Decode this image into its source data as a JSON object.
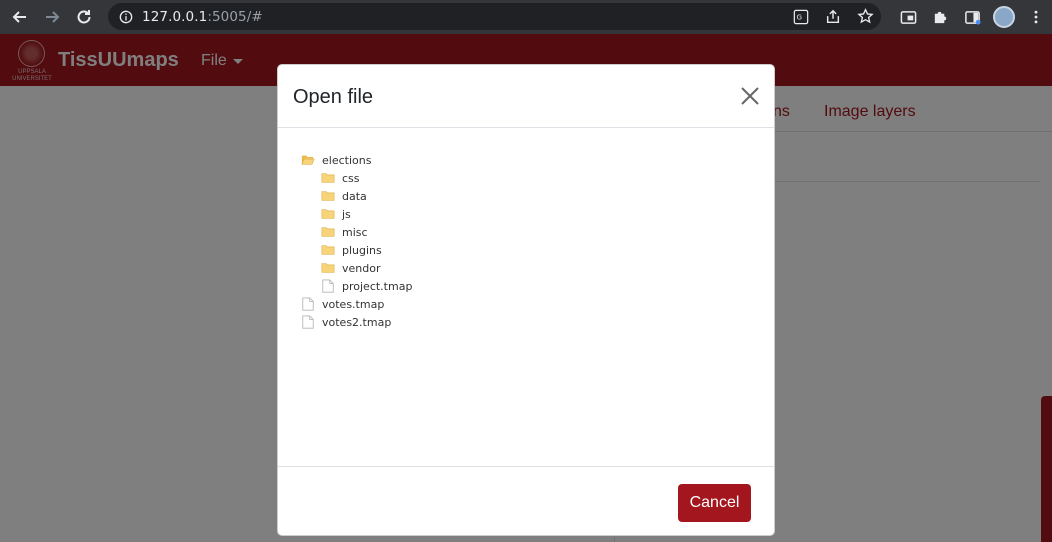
{
  "browser": {
    "url_host": "127.0.0.1",
    "url_rest": ":5005/#"
  },
  "app": {
    "title": "TissUUmaps",
    "logo_text_line1": "UPPSALA",
    "logo_text_line2": "UNIVERSITET",
    "file_menu": "File",
    "tab_partial": "ns",
    "tab_image_layers": "Image layers"
  },
  "modal": {
    "title": "Open file",
    "cancel_label": "Cancel",
    "tree": [
      {
        "label": "elections",
        "type": "folder-open"
      },
      {
        "label": "css",
        "type": "folder"
      },
      {
        "label": "data",
        "type": "folder"
      },
      {
        "label": "js",
        "type": "folder"
      },
      {
        "label": "misc",
        "type": "folder"
      },
      {
        "label": "plugins",
        "type": "folder"
      },
      {
        "label": "vendor",
        "type": "folder"
      },
      {
        "label": "project.tmap",
        "type": "file"
      },
      {
        "label": "votes.tmap",
        "type": "file"
      },
      {
        "label": "votes2.tmap",
        "type": "file"
      }
    ]
  },
  "colors": {
    "brand": "#a4161e",
    "chrome_bg": "#35363a",
    "omnibox_bg": "#202124",
    "folder": "#f5c242"
  }
}
